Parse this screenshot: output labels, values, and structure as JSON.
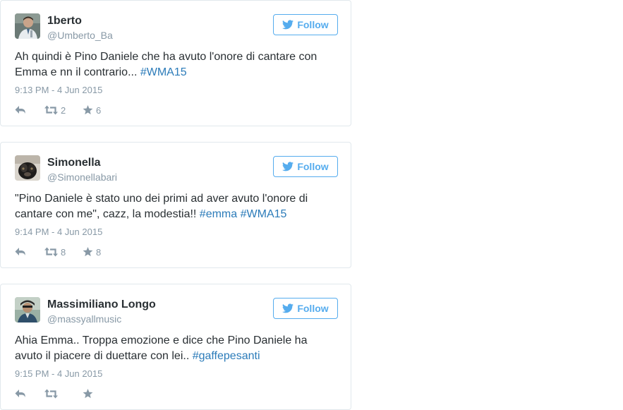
{
  "follow_label": "Follow",
  "colors": {
    "accent": "#55acee",
    "link": "#2b7bb9",
    "muted": "#8899a6",
    "text": "#292f33",
    "border": "#e1e8ed"
  },
  "icons": {
    "follow": "twitter-bird-icon",
    "reply": "reply-icon",
    "retweet": "retweet-icon",
    "favorite": "star-icon"
  },
  "tweets": [
    {
      "name": "1berto",
      "handle": "@Umberto_Ba",
      "text": "Ah quindi è Pino Daniele che ha avuto l'onore di cantare con Emma e nn il contrario... ",
      "hashtags": [
        "#WMA15"
      ],
      "time": "9:13 PM - 4 Jun 2015",
      "retweets": "2",
      "favorites": "6"
    },
    {
      "name": "Simonella",
      "handle": "@Simonellabari",
      "text": "\"Pino Daniele è stato uno dei primi ad aver avuto l'onore di cantare con me\", cazz, la modestia!! ",
      "hashtags": [
        "#emma",
        "#WMA15"
      ],
      "time": "9:14 PM - 4 Jun 2015",
      "retweets": "8",
      "favorites": "8"
    },
    {
      "name": "Massimiliano Longo",
      "handle": "@massyallmusic",
      "text": "Ahia  Emma.. Troppa emozione e dice che Pino Daniele ha avuto il piacere di duettare con lei.. ",
      "hashtags": [
        "#gaffepesanti"
      ],
      "time": "9:15 PM - 4 Jun 2015",
      "retweets": "",
      "favorites": ""
    }
  ]
}
